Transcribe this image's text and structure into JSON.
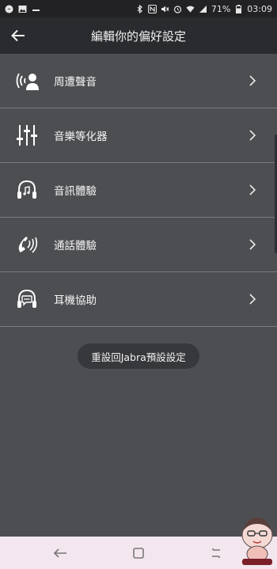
{
  "status_bar": {
    "battery": "71%",
    "time": "03:09",
    "left_icons": [
      "facebook-messenger-icon",
      "image-icon",
      "app-notification-icon"
    ],
    "right_icons": [
      "bluetooth-icon",
      "nfc-icon",
      "mute-icon",
      "alarm-icon",
      "wifi-icon",
      "signal-icon",
      "battery-icon"
    ]
  },
  "header": {
    "title": "編輯你的偏好設定",
    "back_icon": "arrow-left-icon"
  },
  "menu": {
    "items": [
      {
        "label": "周遭聲音",
        "icon": "hear-through-person-icon"
      },
      {
        "label": "音樂等化器",
        "icon": "equalizer-sliders-icon"
      },
      {
        "label": "音訊體驗",
        "icon": "headphones-music-icon"
      },
      {
        "label": "通話體驗",
        "icon": "phone-call-icon"
      },
      {
        "label": "耳機協助",
        "icon": "headphones-chat-icon"
      }
    ],
    "chevron_icon": "chevron-right-icon"
  },
  "reset": {
    "label": "重設回Jabra預設設定"
  },
  "nav_bar": {
    "background": "#f3e6ee",
    "buttons": [
      "back-nav-icon",
      "home-nav-icon",
      "recents-nav-icon"
    ]
  }
}
